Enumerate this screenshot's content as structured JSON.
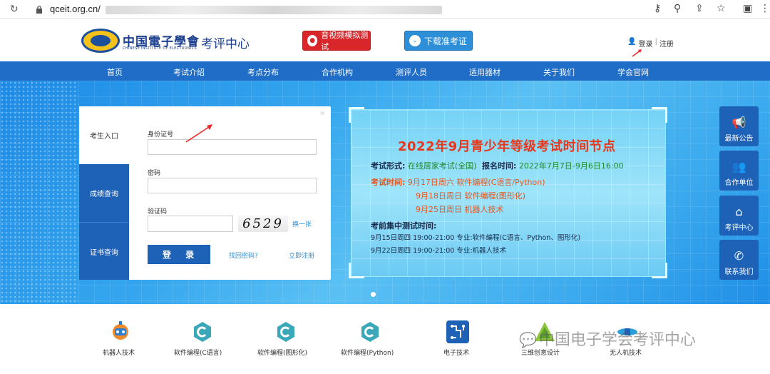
{
  "browser": {
    "url": "qceit.org.cn/"
  },
  "header": {
    "logo_cn": "中国電子學會",
    "logo_en": "CHINESE INSTITUTE OF ELECTRONICS",
    "logo_sub": "考评中心",
    "btn_video_test": "音视频模拟测试",
    "btn_download": "下载准考证",
    "login": "登录",
    "divider": "|",
    "register": "注册"
  },
  "nav": {
    "items": [
      "首页",
      "考试介绍",
      "考点分布",
      "合作机构",
      "测评人员",
      "适用器材",
      "关于我们",
      "学会官网"
    ]
  },
  "login_box": {
    "tabs": [
      "考生入口",
      "成绩查询",
      "证书查询"
    ],
    "id_label": "身份证号",
    "password_label": "密码",
    "captcha_label": "验证码",
    "captcha_value": "6529",
    "refresh": "换一张",
    "submit": "登 录",
    "forgot": "找回密码?",
    "register": "立即注册"
  },
  "poster": {
    "title": "2022年9月青少年等级考试时间节点",
    "mode_label": "考试形式:",
    "mode_value": "在线居家考试(全国)",
    "signup_label": "报名时间:",
    "signup_value": "2022年7月7日-9月6日16:00",
    "time_label": "考试时间:",
    "sessions": [
      {
        "date": "9月17日周六",
        "subject": "软件编程(C语言/Python)"
      },
      {
        "date": "9月18日周日",
        "subject": "软件编程(图形化)"
      },
      {
        "date": "9月25日周日",
        "subject": "机器人技术"
      }
    ],
    "pretest_label": "考前集中测试时间:",
    "pretests": [
      "9月15日周四 19:00-21:00 专业:软件编程(C语言、Python、图形化)",
      "9月22日周四 19:00-21:00 专业:机器人技术"
    ]
  },
  "side": {
    "items": [
      "最新公告",
      "合作单位",
      "考评中心",
      "联系我们"
    ]
  },
  "bottom": {
    "items": [
      "机器人技术",
      "软件编程(C语言)",
      "软件编程(图形化)",
      "软件编程(Python)",
      "电子技术",
      "三维创意设计",
      "无人机技术"
    ]
  },
  "watermark": "中国电子学会考评中心"
}
